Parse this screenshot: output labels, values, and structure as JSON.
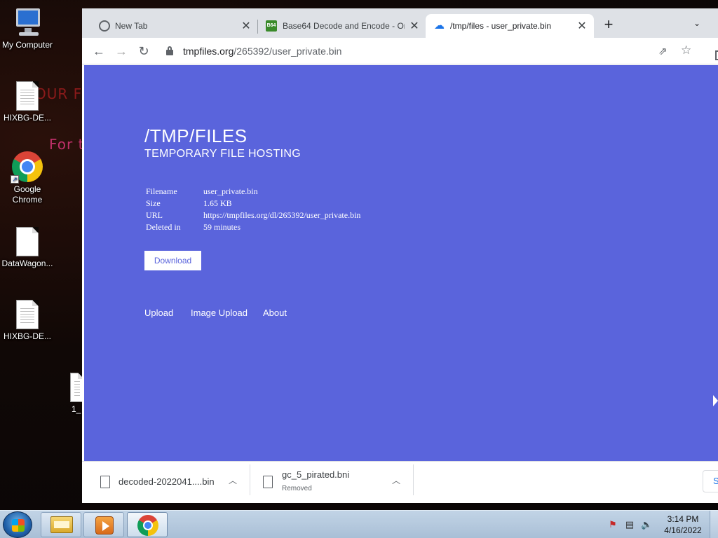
{
  "desktop": {
    "wallpaper_text_1": "OUR F",
    "wallpaper_text_2": "For t",
    "icons": [
      {
        "label": "My Computer",
        "icon": "computer-icon"
      },
      {
        "label": "HIXBG-DE...",
        "icon": "text-file-icon"
      },
      {
        "label": "Google Chrome",
        "icon": "chrome-icon"
      },
      {
        "label": "DataWagon...",
        "icon": "file-icon"
      },
      {
        "label": "HIXBG-DE...",
        "icon": "text-file-icon"
      },
      {
        "label": "1_",
        "icon": "text-file-icon"
      }
    ]
  },
  "browser": {
    "tabs": [
      {
        "title": "New Tab",
        "icon": "globe-icon",
        "active": false
      },
      {
        "title": "Base64 Decode and Encode - Onl",
        "icon": "b64-icon",
        "icon_text": "B64",
        "active": false
      },
      {
        "title": "/tmp/files - user_private.bin",
        "icon": "cloud-icon",
        "active": true
      }
    ],
    "new_tab_label": "+",
    "tab_search_icon": "chevron-down-icon",
    "url_host": "tmpfiles.org",
    "url_path": "/265392/user_private.bin"
  },
  "page": {
    "background_color": "#5a64dc",
    "title": "/TMP/FILES",
    "subtitle": "TEMPORARY FILE HOSTING",
    "info": [
      {
        "key": "Filename",
        "value": "user_private.bin"
      },
      {
        "key": "Size",
        "value": "1.65 KB"
      },
      {
        "key": "URL",
        "value": "https://tmpfiles.org/dl/265392/user_private.bin"
      },
      {
        "key": "Deleted in",
        "value": "59 minutes"
      }
    ],
    "download_label": "Download",
    "links": [
      "Upload",
      "Image Upload",
      "About"
    ]
  },
  "downloads": {
    "items": [
      {
        "name": "decoded-2022041....bin",
        "status": ""
      },
      {
        "name": "gc_5_pirated.bni",
        "status": "Removed"
      }
    ],
    "show_all_label": "S"
  },
  "taskbar": {
    "clock_time": "3:14 PM",
    "clock_date": "4/16/2022"
  }
}
